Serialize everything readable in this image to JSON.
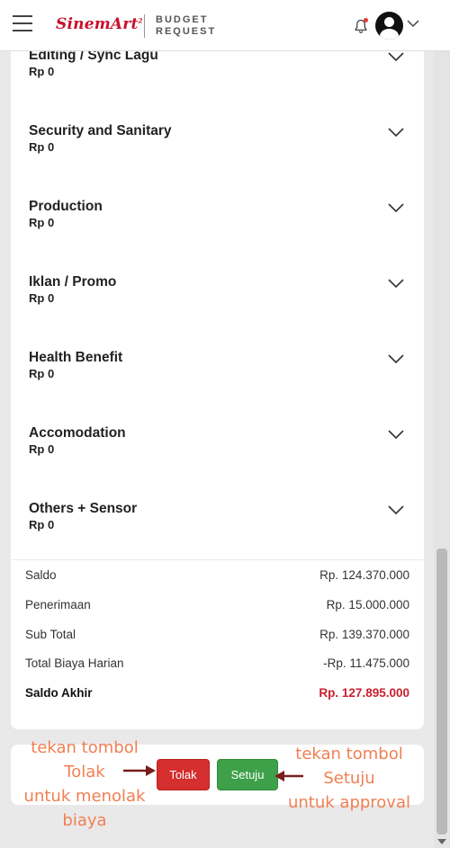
{
  "header": {
    "menu_icon": "hamburger-icon",
    "logo_script": "SinemArt",
    "logo_sup": "2",
    "logo_line1": "BUDGET",
    "logo_line2": "REQUEST",
    "notification_icon": "bell-icon",
    "notification_dot_color": "#e53935",
    "avatar_icon": "user-avatar-icon",
    "avatar_chevron_icon": "chevron-down-icon"
  },
  "accordion": [
    {
      "title": "Editing / Sync Lagu",
      "value": "Rp 0"
    },
    {
      "title": "Security and Sanitary",
      "value": "Rp 0"
    },
    {
      "title": "Production",
      "value": "Rp 0"
    },
    {
      "title": "Iklan / Promo",
      "value": "Rp 0"
    },
    {
      "title": "Health Benefit",
      "value": "Rp 0"
    },
    {
      "title": "Accomodation",
      "value": "Rp 0"
    },
    {
      "title": "Others + Sensor",
      "value": "Rp 0"
    }
  ],
  "summary": [
    {
      "label": "Saldo",
      "value": "Rp. 124.370.000"
    },
    {
      "label": "Penerimaan",
      "value": "Rp. 15.000.000"
    },
    {
      "label": "Sub Total",
      "value": "Rp. 139.370.000"
    },
    {
      "label": "Total Biaya Harian",
      "value": "-Rp. 11.475.000"
    },
    {
      "label": "Saldo Akhir",
      "value": "Rp. 127.895.000"
    }
  ],
  "actions": {
    "reject_label": "Tolak",
    "approve_label": "Setuju",
    "reject_color": "#d42e2e",
    "approve_color": "#3ea14a"
  },
  "annotations": {
    "left_line1": "tekan tombol",
    "left_line2": "Tolak",
    "left_line3": "untuk menolak",
    "left_line4": "biaya",
    "right_line1": "tekan tombol",
    "right_line2": "Setuju",
    "right_line3": "untuk approval",
    "color": "#f07f52"
  },
  "brand_color": "#c8102e"
}
